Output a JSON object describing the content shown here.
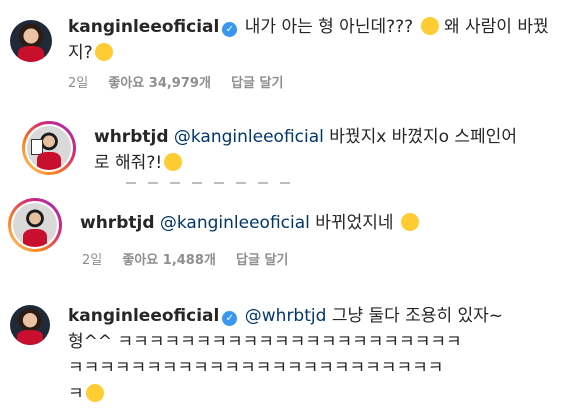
{
  "comments": [
    {
      "username": "kanginleeoficial",
      "verified": true,
      "text_line1": "내가 아는 형 아닌데???",
      "text_line1b": "왜 사람이 바꿨",
      "text_line2": "지?",
      "time": "2일",
      "likes": "좋아요 34,979개",
      "reply": "답글 달기"
    },
    {
      "username": "whrbtjd",
      "mention": "@kanginleeoficial",
      "text_line1": "바꿨지x 바꼈지o 스페인어",
      "text_line2": "로 해줘?!"
    },
    {
      "username": "whrbtjd",
      "mention": "@kanginleeoficial",
      "text": "바뀌었지네",
      "time": "2일",
      "likes": "좋아요 1,488개",
      "reply": "답글 달기"
    },
    {
      "username": "kanginleeoficial",
      "verified": true,
      "mention": "@whrbtjd",
      "text_line1": "그냥 둘다 조용히 있자~",
      "text_line2": "형^^ ㅋㅋㅋㅋㅋㅋㅋㅋㅋㅋㅋㅋㅋㅋㅋㅋㅋㅋㅋㅋㅋㅋ",
      "text_line3": "ㅋㅋㅋㅋㅋㅋㅋㅋㅋㅋㅋㅋㅋㅋㅋㅋㅋㅋㅋㅋㅋㅋㅋㅋ",
      "text_line4": "ㅋ"
    }
  ],
  "colors": {
    "text": "#262626",
    "meta": "#8e8e8e",
    "mention": "#00376b",
    "verified": "#3897f0"
  },
  "icons": [
    "verified-badge-icon",
    "emoji-icon"
  ]
}
